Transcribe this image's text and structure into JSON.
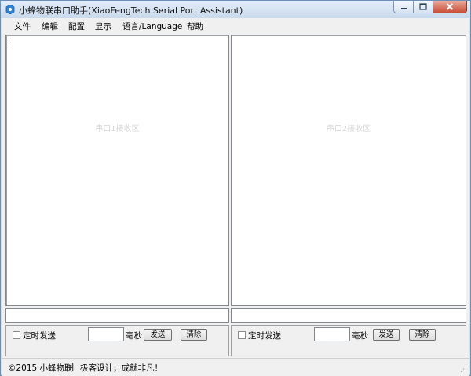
{
  "window": {
    "title": "小蜂物联串口助手(XiaoFengTech Serial Port Assistant)"
  },
  "menu": [
    "文件",
    "编辑",
    "配置",
    "显示",
    "语言/Language",
    "帮助"
  ],
  "receive_left": {
    "hint": "串口1接收区"
  },
  "receive_right": {
    "hint": "串口2接收区"
  },
  "send_left": {
    "timed_label": "定时发送",
    "interval_value": "",
    "unit": "毫秒",
    "send_label": "发送",
    "clear_label": "清除"
  },
  "send_right": {
    "timed_label": "定时发送",
    "interval_value": "",
    "unit": "毫秒",
    "send_label": "发送",
    "clear_label": "清除"
  },
  "status": {
    "copyright": "©2015 小蜂物联",
    "separator": "|",
    "slogan": "极客设计，成就非凡！"
  },
  "colors": {
    "titlebar": "#c9daee",
    "close_button": "#c94f38"
  }
}
